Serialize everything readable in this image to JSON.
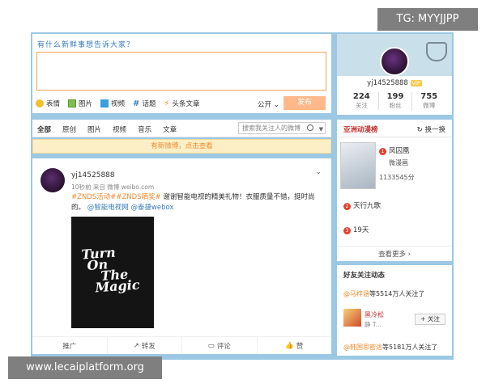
{
  "composer": {
    "prompt": "有什么新鲜事想告诉大家？",
    "tools": [
      {
        "icon": "smiley-icon",
        "label": "表情"
      },
      {
        "icon": "image-icon",
        "label": "图片"
      },
      {
        "icon": "video-icon",
        "label": "视频"
      },
      {
        "icon": "hashtag-icon",
        "label": "话题"
      },
      {
        "icon": "article-icon",
        "label": "头条文章"
      }
    ],
    "visibility": "公开 ⌄",
    "publish_label": "发布"
  },
  "feed": {
    "tabs": [
      "全部",
      "原创",
      "图片",
      "视频",
      "音乐",
      "文章"
    ],
    "search_placeholder": "搜索我关注人的微博",
    "new_bar": "有新微博，点击查看"
  },
  "post": {
    "user": "yj14525888",
    "meta": "10秒前 来自 微博 weibo.com",
    "hashtags": "#ZNDS活动##ZNDS晒奖#",
    "text": " 谢谢智能电视的精美礼物！衣服质量不错，挺时尚的。",
    "mention1": "@智能电视网",
    "mention2": "@泰捷webox",
    "tee": [
      "Turn",
      "On",
      "The",
      "Magic"
    ],
    "actions": [
      "推广",
      "转发",
      "评论",
      "赞"
    ]
  },
  "profile": {
    "name": "yj14525888",
    "vip": "VIP",
    "stats": [
      {
        "n": "224",
        "l": "关注"
      },
      {
        "n": "199",
        "l": "粉丝"
      },
      {
        "n": "755",
        "l": "微博"
      }
    ]
  },
  "hot": {
    "title": "亚洲动漫榜",
    "refresh": "换一换",
    "item1": "凤囚凰",
    "item1_sub": "微漫画",
    "item1_count": "1133545分",
    "item2": "天行九歌",
    "item3": "19天",
    "more": "查看更多 ›"
  },
  "friends": {
    "title": "好友关注动态",
    "line1_at": "@马梓涵",
    "line1_rest": "等5514万人关注了",
    "name": "黑冷松",
    "sub": "静 T...",
    "follow": "+ 关注",
    "line2_at": "@韩国思密达",
    "line2_rest": "等5181万人关注了"
  },
  "watermarks": {
    "top": "TG: MYYJJPP",
    "bottom": "www.lecaiplatform.org"
  },
  "colors": {
    "page_bg": "#9cc8e4",
    "accent_orange": "#f28a2e",
    "link_blue": "#3a7bbf",
    "rank_red": "#c8302f"
  }
}
